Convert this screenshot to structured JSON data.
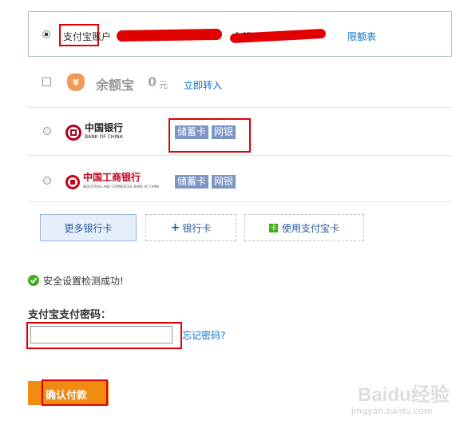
{
  "alipay_account": {
    "label_prefix": "支付宝",
    "label_suffix": "账户",
    "limit_link": "限额表",
    "balance_label": "余额"
  },
  "yuebao": {
    "name": "余额宝",
    "amount": "0",
    "currency": "元",
    "transfer_link": "立即转入",
    "icon_glyph": "¥"
  },
  "banks": [
    {
      "name_cn": "中国银行",
      "name_en": "BANK OF CHINA",
      "tags": [
        "储蓄卡",
        "网银"
      ]
    },
    {
      "name_cn": "中国工商银行",
      "name_en": "INDUSTRIAL AND COMMERCIAL BANK OF CHINA",
      "tags": [
        "储蓄卡",
        "网银"
      ]
    }
  ],
  "actions": {
    "more_cards": "更多银行卡",
    "add_card_plus": "+",
    "add_card": "银行卡",
    "use_alipay_card_icon": "卡",
    "use_alipay_card": "使用支付宝卡"
  },
  "security": {
    "status_text": "安全设置检测成功!"
  },
  "password": {
    "label": "支付宝支付密码：",
    "value": "",
    "forgot_link": "忘记密码?"
  },
  "confirm_button": "确认付款",
  "watermark": {
    "brand": "Baidu经验",
    "url": "jingyan.baidu.com"
  },
  "colors": {
    "link": "#0d6dc7",
    "annotation_red": "#e00000",
    "confirm_orange": "#f08a10",
    "tag_blue": "#7c95c4",
    "success_green": "#3fae1d",
    "yuebao_orange": "#f09a5a"
  }
}
